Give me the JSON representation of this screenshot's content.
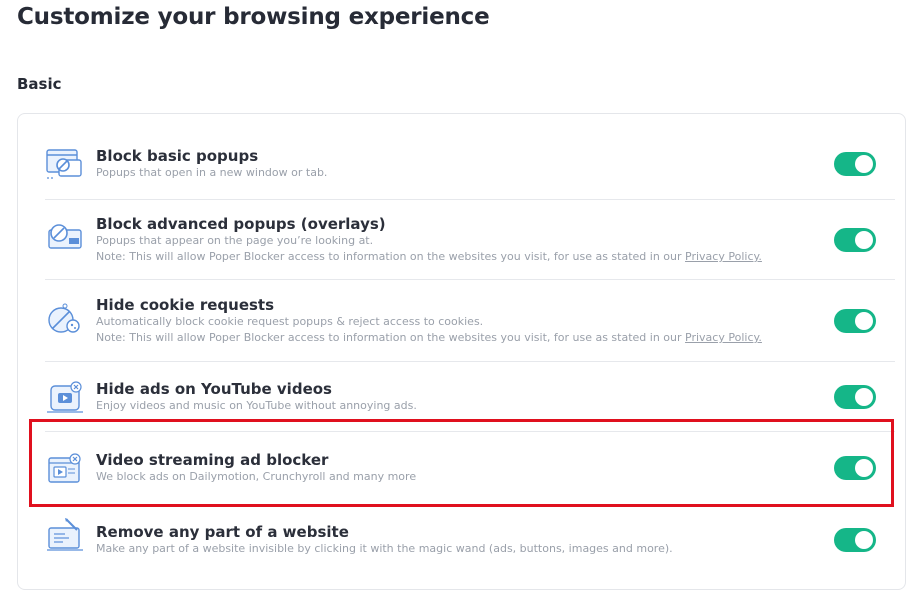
{
  "page": {
    "title": "Customize your browsing experience",
    "section_title": "Basic"
  },
  "settings": [
    {
      "icon": "popup-window-block-icon",
      "title": "Block basic popups",
      "description": "Popups that open in a new window or tab.",
      "enabled": true
    },
    {
      "icon": "overlay-block-icon",
      "title": "Block advanced popups (overlays)",
      "description": "Popups that appear on the page you’re looking at.",
      "note_prefix": "Note: This will allow Poper Blocker access to information on the websites you visit, for use as stated in our ",
      "note_link": "Privacy Policy.",
      "enabled": true
    },
    {
      "icon": "cookie-block-icon",
      "title": "Hide cookie requests",
      "description": "Automatically block cookie request popups & reject access to cookies.",
      "note_prefix": "Note: This will allow Poper Blocker access to information on the websites you visit, for use as stated in our ",
      "note_link": "Privacy Policy.",
      "enabled": true
    },
    {
      "icon": "youtube-ad-block-icon",
      "title": "Hide ads on YouTube videos",
      "description": "Enjoy videos and music on YouTube without annoying ads.",
      "enabled": true
    },
    {
      "icon": "video-streaming-block-icon",
      "title": "Video streaming ad blocker",
      "description": "We block ads on Dailymotion, Crunchyroll and many more",
      "enabled": true
    },
    {
      "icon": "magic-wand-icon",
      "title": "Remove any part of a website",
      "description": "Make any part of a website invisible by clicking it with the magic wand (ads, buttons, images and more).",
      "enabled": true
    }
  ],
  "colors": {
    "toggle_on": "#15b688",
    "highlight": "#e0101e",
    "icon_blue": "#5b8fd9"
  }
}
